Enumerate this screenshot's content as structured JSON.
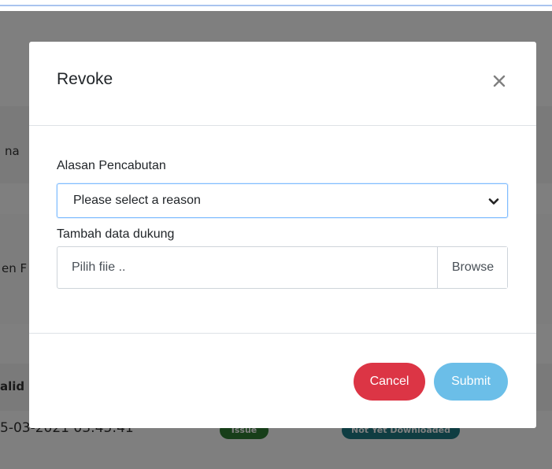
{
  "background": {
    "row1_fragment": "na",
    "row2_fragment": "en F",
    "header_fragment": "alid",
    "date_fragment": "5-03-2021 03:45:41",
    "badge_status": "Issue",
    "badge_download": "Not Yet Downloaded",
    "colors": {
      "issue": "#2e7d32",
      "download": "#1f7a85"
    }
  },
  "modal": {
    "title": "Revoke",
    "close_icon": "close-icon",
    "reason_label": "Alasan Pencabutan",
    "reason_select": {
      "selected": "Please select a reason",
      "icon": "chevron-down-icon"
    },
    "support_label": "Tambah data dukung",
    "file_input": {
      "placeholder": "Pilih fiie ..",
      "browse_label": "Browse"
    },
    "footer": {
      "cancel_label": "Cancel",
      "submit_label": "Submit"
    },
    "colors": {
      "cancel": "#dc3545",
      "submit": "#5bb8e6",
      "focus_border": "#80bdff"
    }
  }
}
